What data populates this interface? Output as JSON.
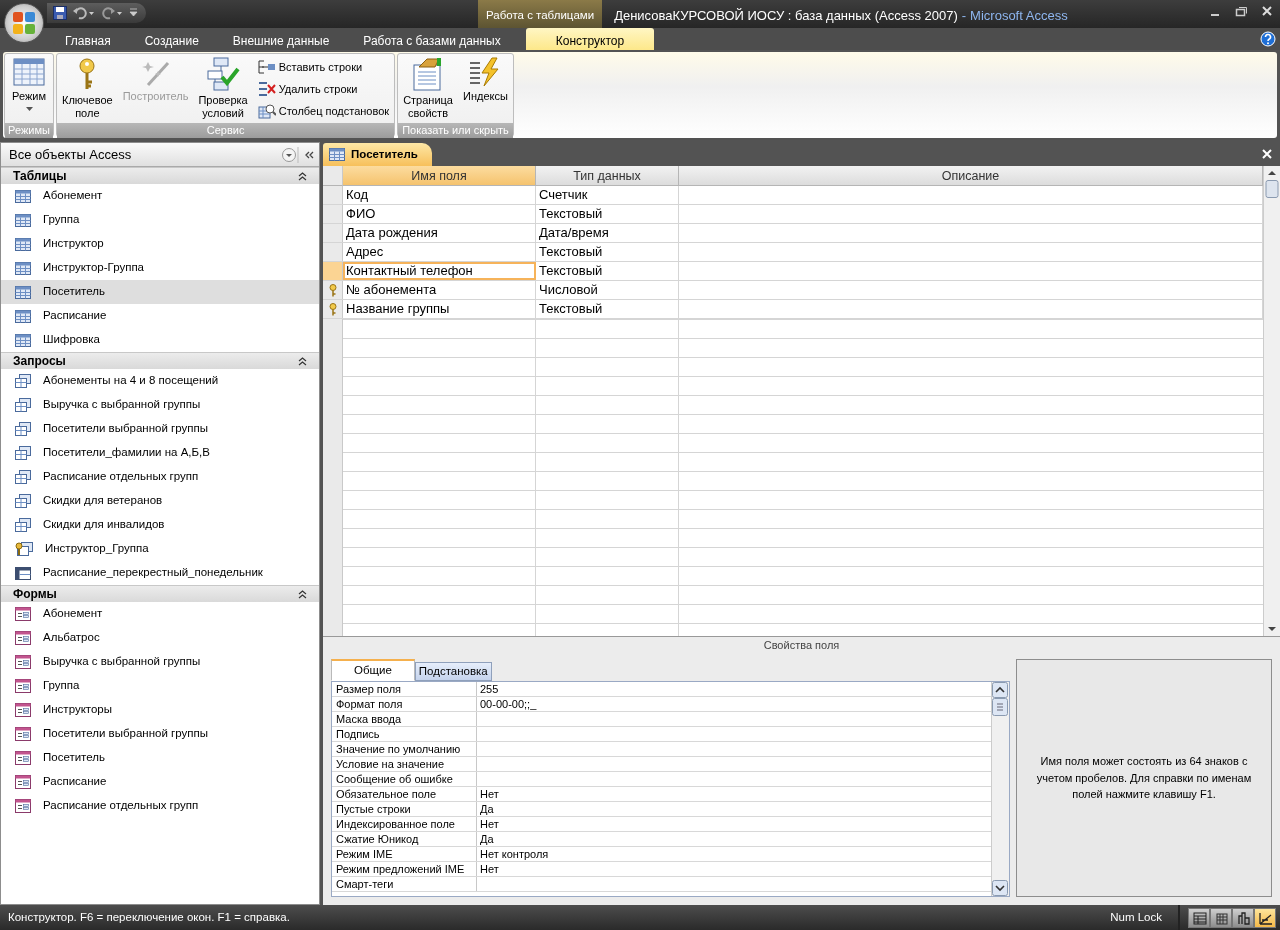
{
  "window": {
    "context_tab": "Работа с таблицами",
    "title": "ДенисоваКУРСОВОЙ ИОСУ : база данных (Access 2007)",
    "separator": "-",
    "app": "Microsoft Access"
  },
  "ribbon_tabs": [
    {
      "label": "Главная",
      "selected": false
    },
    {
      "label": "Создание",
      "selected": false
    },
    {
      "label": "Внешние данные",
      "selected": false
    },
    {
      "label": "Работа с базами данных",
      "selected": false
    },
    {
      "label": "Конструктор",
      "selected": true
    }
  ],
  "ribbon_groups": [
    {
      "label": "Режимы",
      "buttons": [
        {
          "label": "Режим",
          "kind": "view",
          "disabled": false,
          "dropdown": true
        }
      ]
    },
    {
      "label": "Сервис",
      "buttons": [
        {
          "label": "Ключевое поле",
          "kind": "key",
          "disabled": false
        },
        {
          "label": "Построитель",
          "kind": "builder",
          "disabled": true
        },
        {
          "label": "Проверка условий",
          "kind": "validate",
          "disabled": false
        },
        {
          "label": "Вставить строки",
          "kind": "insert_rows",
          "disabled": false
        },
        {
          "label": "Удалить строки",
          "kind": "delete_rows",
          "disabled": false
        },
        {
          "label": "Столбец  подстановок",
          "kind": "lookup",
          "disabled": false
        }
      ]
    },
    {
      "label": "Показать или скрыть",
      "buttons": [
        {
          "label": "Страница свойств",
          "kind": "property_sheet",
          "disabled": false
        },
        {
          "label": "Индексы",
          "kind": "indexes",
          "disabled": false
        }
      ]
    }
  ],
  "navigation": {
    "title": "Все объекты Access",
    "groups": [
      {
        "label": "Таблицы",
        "expanded": true,
        "items": [
          {
            "label": "Абонемент",
            "kind": "table",
            "selected": false
          },
          {
            "label": "Группа",
            "kind": "table",
            "selected": false
          },
          {
            "label": "Инструктор",
            "kind": "table",
            "selected": false
          },
          {
            "label": "Инструктор-Группа",
            "kind": "table",
            "selected": false
          },
          {
            "label": "Посетитель",
            "kind": "table",
            "selected": true
          },
          {
            "label": "Расписание",
            "kind": "table",
            "selected": false
          },
          {
            "label": "Шифровка",
            "kind": "table",
            "selected": false
          }
        ]
      },
      {
        "label": "Запросы",
        "expanded": true,
        "items": [
          {
            "label": "Абонементы на 4 и 8 посещений",
            "kind": "query",
            "selected": false
          },
          {
            "label": "Выручка с выбранной группы",
            "kind": "query",
            "selected": false
          },
          {
            "label": "Посетители выбранной группы",
            "kind": "query",
            "selected": false
          },
          {
            "label": "Посетители_фамилии на А,Б,В",
            "kind": "query",
            "selected": false
          },
          {
            "label": "Расписание отдельных групп",
            "kind": "query",
            "selected": false
          },
          {
            "label": "Скидки для ветеранов",
            "kind": "query",
            "selected": false
          },
          {
            "label": "Скидки для инвалидов",
            "kind": "query",
            "selected": false
          },
          {
            "label": "Инструктор_Группа",
            "kind": "key_query",
            "selected": false
          },
          {
            "label": "Расписание_перекрестный_понедельник",
            "kind": "crosstab",
            "selected": false
          }
        ]
      },
      {
        "label": "Формы",
        "expanded": true,
        "items": [
          {
            "label": "Абонемент",
            "kind": "form",
            "selected": false
          },
          {
            "label": "Альбатрос",
            "kind": "form",
            "selected": false
          },
          {
            "label": "Выручка с выбранной группы",
            "kind": "form",
            "selected": false
          },
          {
            "label": "Группа",
            "kind": "form",
            "selected": false
          },
          {
            "label": "Инструкторы",
            "kind": "form",
            "selected": false
          },
          {
            "label": "Посетители выбранной группы",
            "kind": "form",
            "selected": false
          },
          {
            "label": "Посетитель",
            "kind": "form",
            "selected": false
          },
          {
            "label": "Расписание",
            "kind": "form",
            "selected": false
          },
          {
            "label": "Расписание отдельных групп",
            "kind": "form",
            "selected": false
          }
        ]
      }
    ]
  },
  "document": {
    "tab": "Посетитель",
    "columns": [
      "Имя поля",
      "Тип данных",
      "Описание"
    ],
    "rows": [
      {
        "name": "Код",
        "type": "Счетчик",
        "primary_key": false,
        "selected": false
      },
      {
        "name": "ФИО",
        "type": "Текстовый",
        "primary_key": false,
        "selected": false
      },
      {
        "name": "Дата рождения",
        "type": "Дата/время",
        "primary_key": false,
        "selected": false
      },
      {
        "name": "Адрес",
        "type": "Текстовый",
        "primary_key": false,
        "selected": false
      },
      {
        "name": "Контактный телефон",
        "type": "Текстовый",
        "primary_key": false,
        "selected": true
      },
      {
        "name": "№ абонемента",
        "type": "Числовой",
        "primary_key": true,
        "selected": false
      },
      {
        "name": "Название группы",
        "type": "Текстовый",
        "primary_key": true,
        "selected": false
      }
    ]
  },
  "field_properties": {
    "title": "Свойства поля",
    "tabs": [
      {
        "label": "Общие",
        "selected": true
      },
      {
        "label": "Подстановка",
        "selected": false
      }
    ],
    "rows": [
      {
        "label": "Размер поля",
        "value": "255"
      },
      {
        "label": "Формат поля",
        "value": "00-00-00;;_"
      },
      {
        "label": "Маска ввода"
      },
      {
        "label": "Подпись"
      },
      {
        "label": "Значение по умолчанию"
      },
      {
        "label": "Условие на значение"
      },
      {
        "label": "Сообщение об ошибке"
      },
      {
        "label": "Обязательное поле",
        "value": "Нет"
      },
      {
        "label": "Пустые строки",
        "value": "Да"
      },
      {
        "label": "Индексированное поле",
        "value": "Нет"
      },
      {
        "label": "Сжатие Юникод",
        "value": "Да"
      },
      {
        "label": "Режим IME",
        "value": "Нет контроля"
      },
      {
        "label": "Режим предложений IME",
        "value": "Нет"
      },
      {
        "label": "Смарт-теги"
      }
    ],
    "help": "Имя поля может состоять из 64 знаков с учетом пробелов.  Для справки по именам полей нажмите клавишу F1."
  },
  "status_bar": {
    "text": "Конструктор.  F6 = переключение окон.  F1 = справка.",
    "indicator": "Num Lock",
    "view_buttons": [
      {
        "kind": "datasheet",
        "selected": false
      },
      {
        "kind": "pivot_table",
        "selected": false
      },
      {
        "kind": "pivot_chart",
        "selected": false
      },
      {
        "kind": "design",
        "selected": true
      }
    ]
  }
}
